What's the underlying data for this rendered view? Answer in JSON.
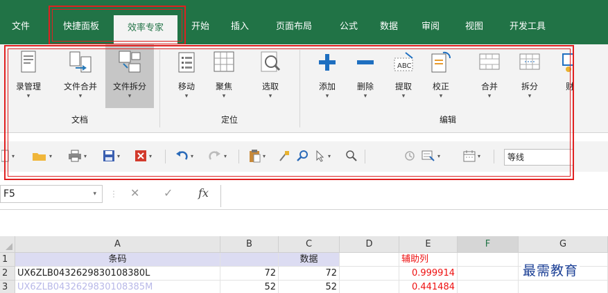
{
  "tabs": [
    {
      "label": "文件",
      "active": false
    },
    {
      "label": "快捷面板",
      "active": false
    },
    {
      "label": "效率专家",
      "active": true
    },
    {
      "label": "开始",
      "active": false
    },
    {
      "label": "插入",
      "active": false
    },
    {
      "label": "页面布局",
      "active": false
    },
    {
      "label": "公式",
      "active": false
    },
    {
      "label": "数据",
      "active": false
    },
    {
      "label": "审阅",
      "active": false
    },
    {
      "label": "视图",
      "active": false
    },
    {
      "label": "开发工具",
      "active": false
    }
  ],
  "ribbon": {
    "groups": {
      "document": "文档",
      "locate": "定位",
      "edit": "编辑"
    },
    "buttons": {
      "catalog": "录管理",
      "merge_files": "文件合并",
      "split_files": "文件拆分",
      "move": "移动",
      "focus": "聚焦",
      "select": "选取",
      "add": "添加",
      "delete": "删除",
      "extract": "提取",
      "correct": "校正",
      "merge": "合并",
      "split": "拆分",
      "cut_off": "财"
    }
  },
  "qat": {
    "font_name": "等线"
  },
  "formula_bar": {
    "name_box": "F5",
    "cancel_glyph": "✕",
    "enter_glyph": "✓",
    "fx_glyph": "fx",
    "value": ""
  },
  "grid": {
    "columns": [
      "A",
      "B",
      "C",
      "D",
      "E",
      "F",
      "G"
    ],
    "rows": [
      {
        "num": "1",
        "A": "条码",
        "B": "",
        "C": "数据",
        "D": "",
        "E": "辅助列",
        "F": "",
        "G": ""
      },
      {
        "num": "2",
        "A": "UX6ZLB0432629830108380L",
        "B": "72",
        "C": "72",
        "D": "",
        "E": "0.999914",
        "F": "",
        "G": ""
      },
      {
        "num": "3",
        "A": "UX6ZLB0432629830108385M",
        "B": "52",
        "C": "52",
        "D": "",
        "E": "0.441484",
        "F": "",
        "G": ""
      }
    ]
  },
  "watermark": "最需教育",
  "colors": {
    "ribbon_green": "#217346",
    "highlight_red": "#e02020",
    "header_fill": "#dcdcf2",
    "error_red": "#ee1111"
  }
}
